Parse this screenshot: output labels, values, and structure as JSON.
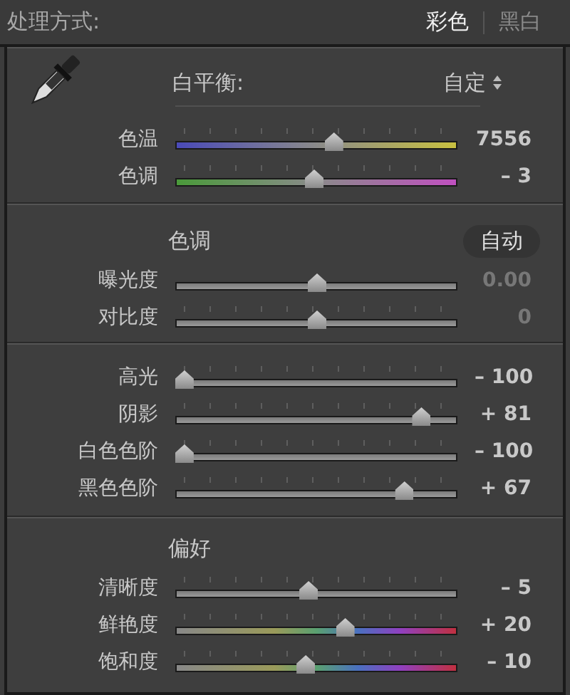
{
  "treatment": {
    "label": "处理方式:",
    "options": [
      {
        "label": "彩色",
        "selected": true
      },
      {
        "label": "黑白",
        "selected": false
      }
    ]
  },
  "white_balance": {
    "label": "白平衡:",
    "value": "自定",
    "sliders": [
      {
        "label": "色温",
        "kind": "temp",
        "level": 0.56,
        "reading": "7556",
        "disabled": false,
        "ticks": true
      },
      {
        "label": "色调",
        "kind": "tint",
        "level": 0.49,
        "reading": "– 3",
        "disabled": false,
        "ticks": true
      }
    ]
  },
  "tone": {
    "title": "色调",
    "auto_button": "自动",
    "sliders": [
      {
        "label": "曝光度",
        "kind": "plain",
        "level": 0.5,
        "reading": "0.00",
        "disabled": true,
        "ticks": false
      },
      {
        "label": "对比度",
        "kind": "plain",
        "level": 0.5,
        "reading": "0",
        "disabled": true,
        "ticks": true
      }
    ]
  },
  "tone_detail": {
    "sliders": [
      {
        "label": "高光",
        "kind": "plain",
        "level": 0.03,
        "reading": "– 100",
        "disabled": false,
        "ticks": true
      },
      {
        "label": "阴影",
        "kind": "plain",
        "level": 0.87,
        "reading": "+ 81",
        "disabled": false,
        "ticks": true
      },
      {
        "label": "白色色阶",
        "kind": "plain",
        "level": 0.03,
        "reading": "– 100",
        "disabled": false,
        "ticks": true
      },
      {
        "label": "黑色色阶",
        "kind": "plain",
        "level": 0.81,
        "reading": "+ 67",
        "disabled": false,
        "ticks": true
      }
    ]
  },
  "presence": {
    "title": "偏好",
    "sliders": [
      {
        "label": "清晰度",
        "kind": "plain",
        "level": 0.47,
        "reading": "– 5",
        "disabled": false,
        "ticks": true
      },
      {
        "label": "鲜艳度",
        "kind": "spectrum",
        "level": 0.6,
        "reading": "+ 20",
        "disabled": false,
        "ticks": true
      },
      {
        "label": "饱和度",
        "kind": "spectrum",
        "level": 0.46,
        "reading": "– 10",
        "disabled": false,
        "ticks": true
      }
    ]
  }
}
